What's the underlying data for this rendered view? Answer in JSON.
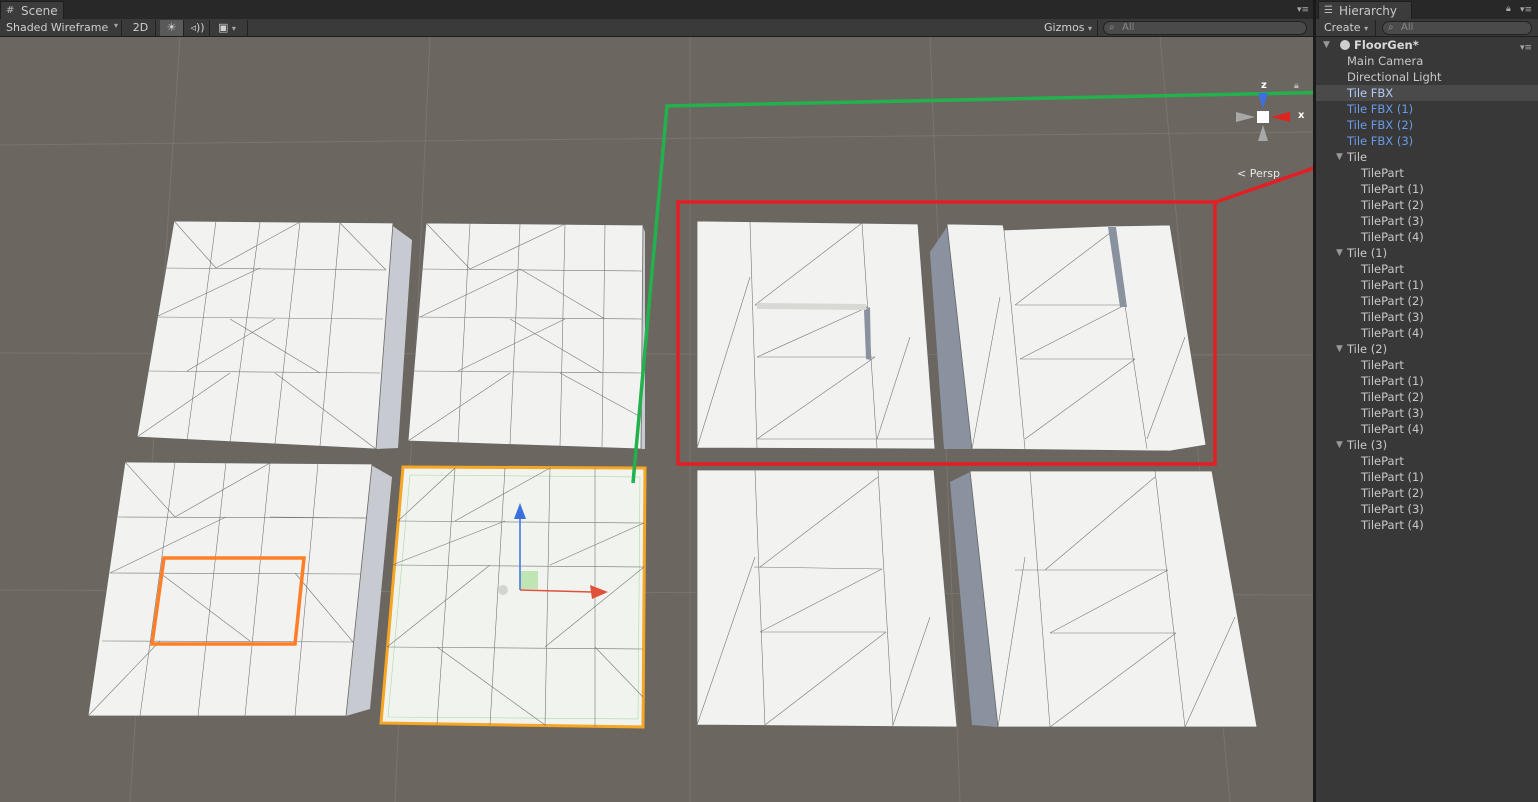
{
  "scene_tab": {
    "label": "Scene"
  },
  "scene_toolbar": {
    "draw_mode": "Shaded Wireframe",
    "mode_2d": "2D",
    "lighting_icon": "sun-icon",
    "audio_icon": "speaker-icon",
    "effects_icon": "image-icon",
    "gizmos_label": "Gizmos",
    "search_placeholder": "All"
  },
  "viewport": {
    "persp_label": "Persp",
    "axis_z": "z",
    "axis_x": "x",
    "annotation_colors": {
      "green": "#22b14c",
      "red": "#e31e24",
      "orange": "#ff7f27",
      "selection": "#f5a623"
    }
  },
  "hierarchy": {
    "tab_label": "Hierarchy",
    "create_label": "Create",
    "search_placeholder": "All",
    "scene_name": "FloorGen*",
    "items": [
      {
        "label": "Main Camera",
        "depth": 1,
        "type": "normal"
      },
      {
        "label": "Directional Light",
        "depth": 1,
        "type": "normal"
      },
      {
        "label": "Tile FBX",
        "depth": 1,
        "type": "prefab-selected"
      },
      {
        "label": "Tile FBX (1)",
        "depth": 1,
        "type": "prefab"
      },
      {
        "label": "Tile FBX (2)",
        "depth": 1,
        "type": "prefab"
      },
      {
        "label": "Tile FBX (3)",
        "depth": 1,
        "type": "prefab"
      },
      {
        "label": "Tile",
        "depth": 1,
        "type": "parent"
      },
      {
        "label": "TilePart",
        "depth": 2,
        "type": "normal"
      },
      {
        "label": "TilePart (1)",
        "depth": 2,
        "type": "normal"
      },
      {
        "label": "TilePart (2)",
        "depth": 2,
        "type": "normal"
      },
      {
        "label": "TilePart (3)",
        "depth": 2,
        "type": "normal"
      },
      {
        "label": "TilePart (4)",
        "depth": 2,
        "type": "normal"
      },
      {
        "label": "Tile (1)",
        "depth": 1,
        "type": "parent"
      },
      {
        "label": "TilePart",
        "depth": 2,
        "type": "normal"
      },
      {
        "label": "TilePart (1)",
        "depth": 2,
        "type": "normal"
      },
      {
        "label": "TilePart (2)",
        "depth": 2,
        "type": "normal"
      },
      {
        "label": "TilePart (3)",
        "depth": 2,
        "type": "normal"
      },
      {
        "label": "TilePart (4)",
        "depth": 2,
        "type": "normal"
      },
      {
        "label": "Tile (2)",
        "depth": 1,
        "type": "parent"
      },
      {
        "label": "TilePart",
        "depth": 2,
        "type": "normal"
      },
      {
        "label": "TilePart (1)",
        "depth": 2,
        "type": "normal"
      },
      {
        "label": "TilePart (2)",
        "depth": 2,
        "type": "normal"
      },
      {
        "label": "TilePart (3)",
        "depth": 2,
        "type": "normal"
      },
      {
        "label": "TilePart (4)",
        "depth": 2,
        "type": "normal"
      },
      {
        "label": "Tile (3)",
        "depth": 1,
        "type": "parent"
      },
      {
        "label": "TilePart",
        "depth": 2,
        "type": "normal"
      },
      {
        "label": "TilePart (1)",
        "depth": 2,
        "type": "normal"
      },
      {
        "label": "TilePart (2)",
        "depth": 2,
        "type": "normal"
      },
      {
        "label": "TilePart (3)",
        "depth": 2,
        "type": "normal"
      },
      {
        "label": "TilePart (4)",
        "depth": 2,
        "type": "normal"
      }
    ]
  }
}
